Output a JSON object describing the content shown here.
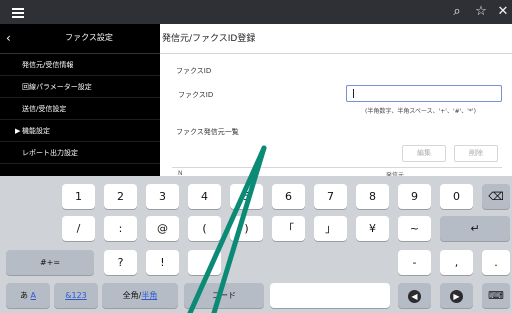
{
  "topbar": {
    "icons": [
      "menu-icon",
      "search-icon",
      "star-icon",
      "close-icon"
    ]
  },
  "sidebar": {
    "back": "‹",
    "title": "ファクス設定",
    "items": [
      {
        "label": "発信元/受信情報"
      },
      {
        "label": "回線パラメーター設定"
      },
      {
        "label": "送信/受信設定"
      },
      {
        "label": "機能設定",
        "arrow": "▶"
      },
      {
        "label": "レポート出力設定"
      }
    ]
  },
  "main": {
    "title": "発信元/ファクスID登録",
    "section_label": "ファクスID",
    "field_label": "ファクスID",
    "field_value": "",
    "hint": "(半角数字、半角スペース、'+'、'#'、'*')",
    "list_label": "ファクス発信元一覧",
    "edit_button": "編集",
    "delete_button": "削除",
    "table_col_a": "N",
    "table_col_b": "発信元"
  },
  "keyboard": {
    "row1": [
      "1",
      "2",
      "3",
      "4",
      "5",
      "6",
      "7",
      "8",
      "9",
      "0"
    ],
    "row2": [
      "/",
      ":",
      "@",
      "(",
      ")",
      "「",
      "」",
      "¥",
      "~"
    ],
    "row3": [
      "#+=",
      "?",
      "!",
      "-",
      ","
    ],
    "kana": "あ",
    "alpha": "A",
    "num": "&123",
    "zenkaku": "全角/",
    "hankaku": "半角",
    "code": "コード",
    "delete_icon": "backspace-icon",
    "enter_icon": "return-icon",
    "dismiss_icon": "keyboard-hide-icon"
  },
  "colors": {
    "topbar": "#2f3036",
    "sidebar": "#000000",
    "keyboard": "#cfd2d7",
    "overlay_stroke": "#0b8a75",
    "accent": "#2a5ad6"
  }
}
